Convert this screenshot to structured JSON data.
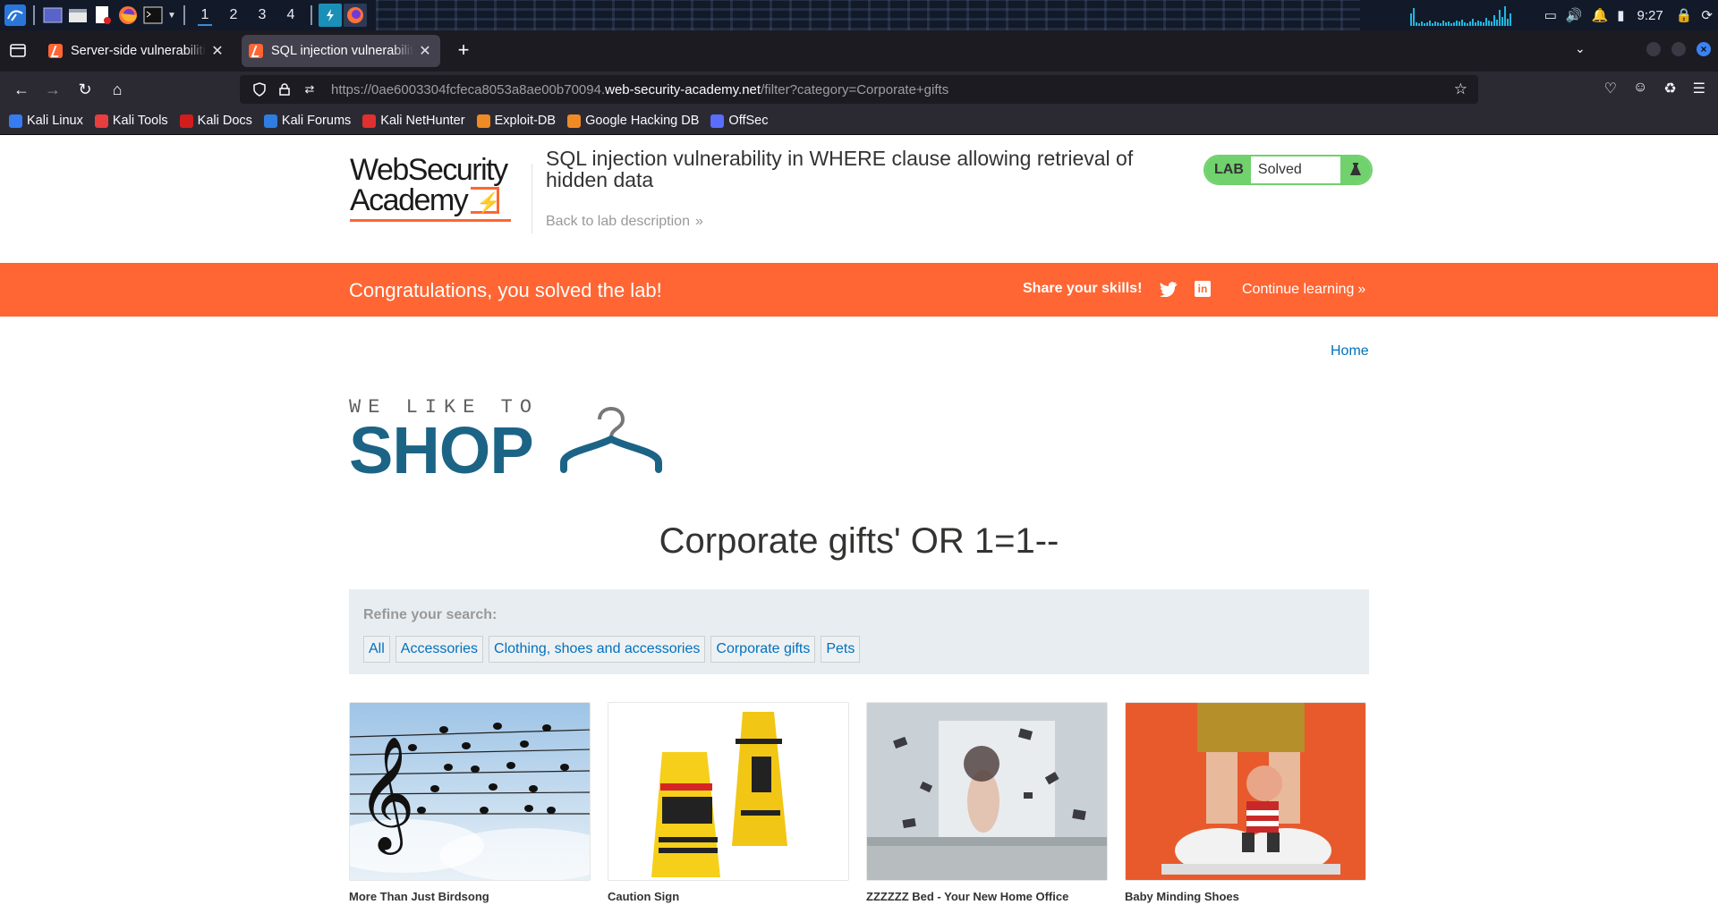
{
  "taskbar": {
    "workspaces": [
      "1",
      "2",
      "3",
      "4"
    ],
    "active_workspace": "1",
    "clock": "9:27"
  },
  "browser": {
    "tabs": [
      {
        "title": "Server-side vulnerabilities",
        "active": false
      },
      {
        "title": "SQL injection vulnerability",
        "active": true
      }
    ],
    "url": {
      "prefix": "https://0ae6003304fcfeca8053a8ae00b70094.",
      "host": "web-security-academy.net",
      "path": "/filter?category=Corporate+gifts"
    },
    "bookmarks": [
      {
        "label": "Kali Linux",
        "color": "#367bf0"
      },
      {
        "label": "Kali Tools",
        "color": "#e83e3e"
      },
      {
        "label": "Kali Docs",
        "color": "#d11d1d"
      },
      {
        "label": "Kali Forums",
        "color": "#2f7de1"
      },
      {
        "label": "Kali NetHunter",
        "color": "#e03030"
      },
      {
        "label": "Exploit-DB",
        "color": "#f08a24"
      },
      {
        "label": "Google Hacking DB",
        "color": "#f08a24"
      },
      {
        "label": "OffSec",
        "color": "#5a6dfb"
      }
    ]
  },
  "lab": {
    "logo_line1": "WebSecurity",
    "logo_line2": "Academy",
    "title": "SQL injection vulnerability in WHERE clause allowing retrieval of hidden data",
    "back_link": "Back to lab description",
    "status_tag": "LAB",
    "status": "Solved"
  },
  "banner": {
    "congrats": "Congratulations, you solved the lab!",
    "share": "Share your skills!",
    "continue": "Continue learning"
  },
  "shop": {
    "home_link": "Home",
    "logo_tagline": "WE LIKE TO",
    "logo_word": "SHOP",
    "heading": "Corporate gifts' OR 1=1--",
    "refine_label": "Refine your search:",
    "categories": [
      "All",
      "Accessories",
      "Clothing, shoes and accessories",
      "Corporate gifts",
      "Pets"
    ],
    "products": [
      {
        "name": "More Than Just Birdsong"
      },
      {
        "name": "Caution Sign"
      },
      {
        "name": "ZZZZZZ Bed - Your New Home Office"
      },
      {
        "name": "Baby Minding Shoes"
      }
    ]
  },
  "colors": {
    "accent": "#ff6633",
    "link": "#0071bc",
    "solved": "#70d16d",
    "shop_blue": "#1c6486"
  }
}
